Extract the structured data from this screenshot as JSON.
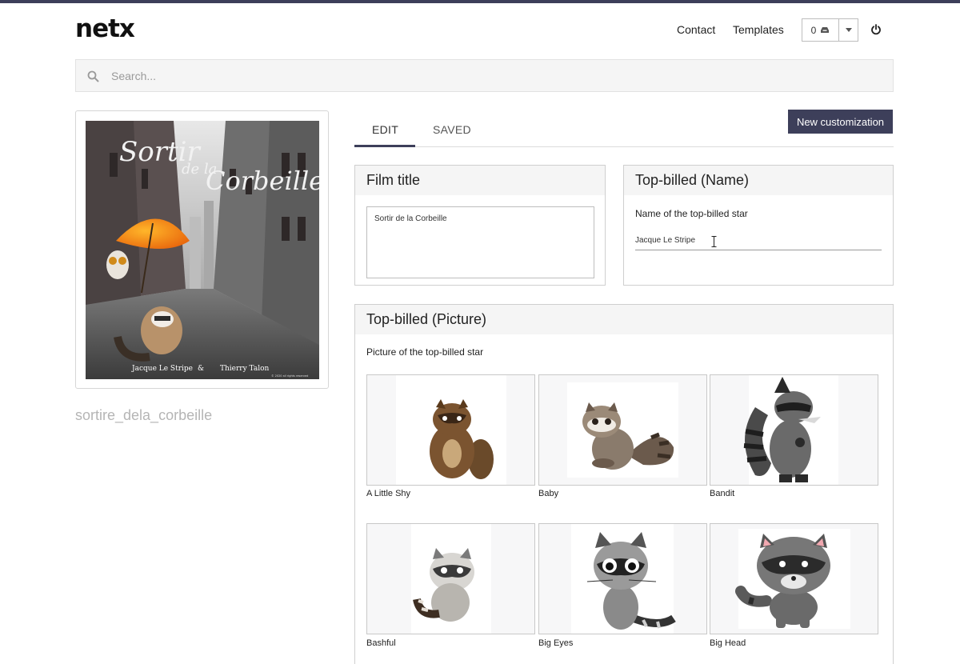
{
  "header": {
    "logo": "netx",
    "nav": {
      "contact": "Contact",
      "templates": "Templates"
    },
    "cart_count": "0",
    "cart_icon": "tray-icon",
    "caret_icon": "caret-down-icon",
    "power_icon": "power-icon"
  },
  "search": {
    "placeholder": "Search...",
    "value": ""
  },
  "preview": {
    "poster": {
      "title_line1": "Sortir",
      "title_line2": "de la",
      "title_line3": "Corbeille",
      "credit_left": "Jacque Le Stripe",
      "credit_amp": "&",
      "credit_right": "Thierry Talon",
      "copyright": "© 2020 all rights reserved"
    },
    "asset_name": "sortire_dela_corbeille"
  },
  "tabs": [
    {
      "label": "EDIT",
      "active": true
    },
    {
      "label": "SAVED",
      "active": false
    }
  ],
  "new_customization_label": "New customization",
  "film_title": {
    "heading": "Film title",
    "value": "Sortir de la Corbeille"
  },
  "top_billed_name": {
    "heading": "Top-billed (Name)",
    "label": "Name of the top-billed star",
    "value": "Jacque Le Stripe"
  },
  "top_billed_picture": {
    "heading": "Top-billed (Picture)",
    "label": "Picture of the top-billed star",
    "options": [
      {
        "label": "A Little Shy"
      },
      {
        "label": "Baby"
      },
      {
        "label": "Bandit"
      },
      {
        "label": "Bashful"
      },
      {
        "label": "Big Eyes"
      },
      {
        "label": "Big Head"
      }
    ]
  },
  "colors": {
    "accent": "#3d3f5a",
    "panel_header": "#f5f5f5",
    "muted_text": "#b5b5b5"
  }
}
